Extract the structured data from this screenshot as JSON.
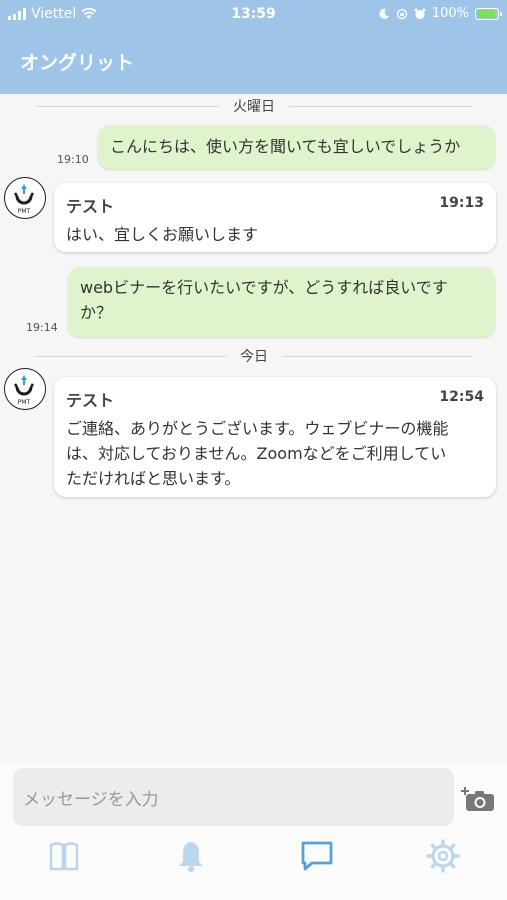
{
  "status_bar": {
    "carrier": "Viettel",
    "time": "13:59",
    "battery": "100%",
    "battery_level": 1.0
  },
  "header": {
    "title": "オングリット"
  },
  "conversation": {
    "day1": "火曜日",
    "m1": {
      "text": "こんにちは、使い方を聞いても宜しいでしょうか",
      "time": "19:10"
    },
    "m2": {
      "sender": "テスト",
      "time": "19:13",
      "text": "はい、宜しくお願いします"
    },
    "m3": {
      "line1": "webビナーを行いたいですが、どうすれば良いです",
      "line2": "か？",
      "time": "19:14"
    },
    "day2": "今日",
    "m4": {
      "sender": "テスト",
      "time": "12:54",
      "line1": "ご連絡、ありがとうございます。ウェブビナーの機能",
      "line2": "は、対応しておりません。Zoomなどをご利用してい",
      "line3": "ただければと思います。"
    }
  },
  "composer": {
    "placeholder": "メッセージを入力"
  },
  "icons": {
    "camera": "camera-add-icon",
    "tabs": [
      "book-icon",
      "bell-icon",
      "chat-icon",
      "gear-icon"
    ],
    "accent": "#9ec5e8",
    "active_tab": "chat"
  }
}
